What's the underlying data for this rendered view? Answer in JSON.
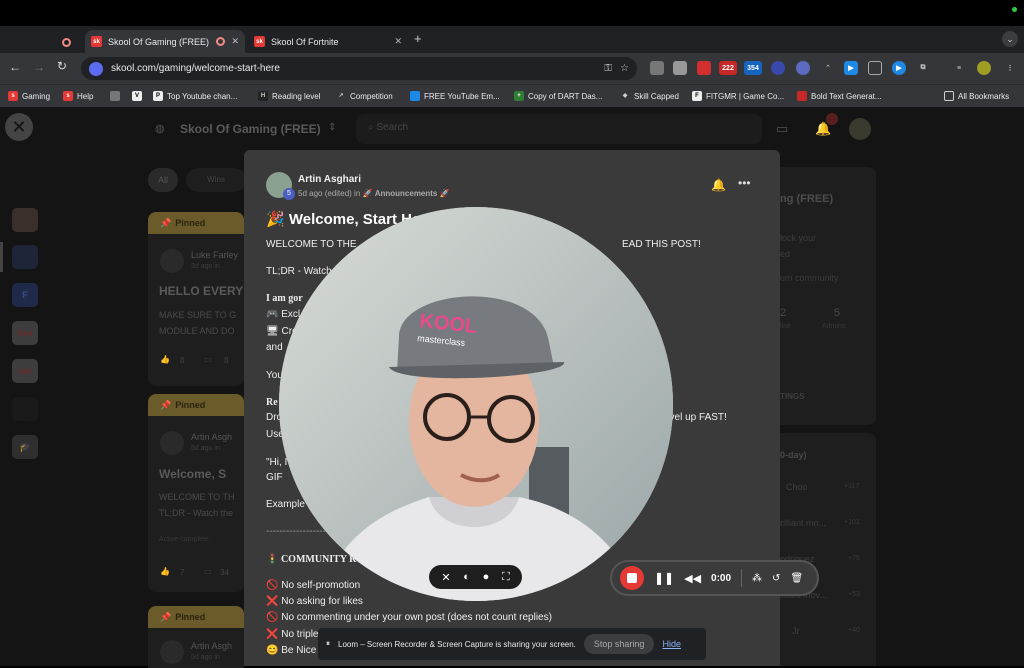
{
  "browser": {
    "tabs": [
      {
        "label": "Skool Of Gaming (FREE)",
        "active": true
      },
      {
        "label": "Skool Of Fortnite",
        "active": false
      }
    ],
    "new_tab": "+",
    "url": "skool.com/gaming/welcome-start-here",
    "ext_badges": [
      "222",
      "354"
    ],
    "bookmarks": [
      "Gaming",
      "Help",
      "",
      "Top Youtube chan...",
      "Reading level",
      "Competition",
      "FREE YouTube Em...",
      "Copy of DART Das...",
      "Skill Capped",
      "FITGMR | Game Co...",
      "Bold Text Generat..."
    ],
    "all_bookmarks": "All Bookmarks"
  },
  "page": {
    "group_name": "Skool Of Gaming (FREE)",
    "search_placeholder": "Search",
    "filters": [
      "All",
      "Wins"
    ],
    "pinned_label": "Pinned",
    "posts": [
      {
        "author": "Luke Farley",
        "meta": "3d ago in",
        "title": "HELLO EVERY",
        "excerpt1": "MAKE SURE TO G",
        "excerpt2": "MODULE AND DO",
        "likes": "8",
        "comments": "8"
      },
      {
        "author": "Artin Asgh",
        "meta": "5d ago in",
        "title": "Welcome, S",
        "excerpt1": "WELCOME TO TH",
        "excerpt2": "TL;DR - Watch the",
        "activity": "Active-complete",
        "likes": "7",
        "comments": "34"
      },
      {
        "author": "Artin Asgh",
        "meta": "5d ago in"
      }
    ],
    "right_col": {
      "title": "ng (FREE)",
      "line1": "lock your",
      "line2": "ed",
      "line3": "um community",
      "stats": [
        {
          "value": "2",
          "label": "line"
        },
        {
          "value": "5",
          "label": "Admins"
        }
      ],
      "settings": "TINGS",
      "leaderboard_title": "0-day)",
      "leaders": [
        {
          "name": "Choo",
          "score": "+117"
        },
        {
          "name": "rilliant mo...",
          "score": "+101"
        },
        {
          "name": "odriguez",
          "score": "+76"
        },
        {
          "name": "illiant mov...",
          "score": "+53"
        },
        {
          "name": "Jr",
          "score": "+40"
        }
      ]
    },
    "side_apps": [
      "",
      "",
      "F",
      "free",
      "sm",
      "",
      ""
    ]
  },
  "modal": {
    "author": "Artin Asghari",
    "level": "5",
    "meta_prefix": "5d ago (edited) in",
    "category": "Announcements",
    "title": "Welcome, Start He",
    "line_welcome": "WELCOME TO THE",
    "line_welcome_end": "EAD THIS POST!",
    "line_tldr": "TL;DR - Watch",
    "line_going": "I am gor",
    "line_excl": "Excl",
    "line_cre": "Cre",
    "line_and": "and",
    "line_you": "You",
    "line_re": "Re",
    "line_dro": "Dro",
    "line_dro_end": "evel up FAST!",
    "line_use": "Use",
    "line_hi": "\"Hi, I",
    "line_gif": "GIF",
    "line_example": "Example",
    "line_dashes": "--------------------",
    "community": "COMMUNITY R",
    "rules": [
      {
        "icon": "🚫",
        "text": "No self-promotion"
      },
      {
        "icon": "❌",
        "text": "No asking for likes"
      },
      {
        "icon": "🚫",
        "text": "No commenting under your own post (does not count replies)"
      },
      {
        "icon": "❌",
        "text": "No triple"
      },
      {
        "icon": "😊",
        "text": "Be Nice"
      }
    ]
  },
  "loom": {
    "timer": "0:00",
    "share_message": "Loom – Screen Recorder & Screen Capture is sharing your screen.",
    "stop_sharing": "Stop sharing",
    "hide": "Hide",
    "cap_text": "KOOL",
    "cap_sub": "masterclass"
  },
  "colors": {
    "accent": "#f2c744",
    "loom_red": "#e53935",
    "modal_bg": "#3a3a3a"
  }
}
